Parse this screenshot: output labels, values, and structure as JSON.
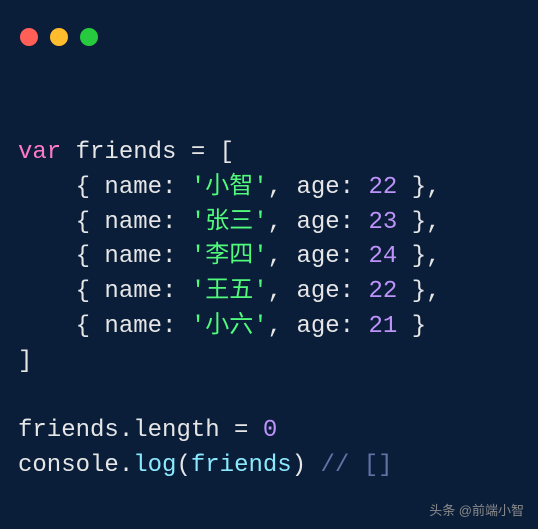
{
  "window": {
    "dots": [
      "red",
      "yellow",
      "green"
    ]
  },
  "code": {
    "var_kw": "var",
    "var_name": "friends",
    "entries": [
      {
        "name": "小智",
        "age": "22",
        "comma": ","
      },
      {
        "name": "张三",
        "age": "23",
        "comma": ","
      },
      {
        "name": "李四",
        "age": "24",
        "comma": ","
      },
      {
        "name": "王五",
        "age": "22",
        "comma": ","
      },
      {
        "name": "小六",
        "age": "21",
        "comma": ""
      }
    ],
    "line2a": "friends",
    "line2b": ".length = ",
    "line2num": "0",
    "line3a": "console",
    "line3b": ".",
    "line3c": "log",
    "line3d": "(",
    "line3e": "friends",
    "line3f": ") ",
    "line3comment": "// []"
  },
  "watermark": "头条 @前端小智"
}
